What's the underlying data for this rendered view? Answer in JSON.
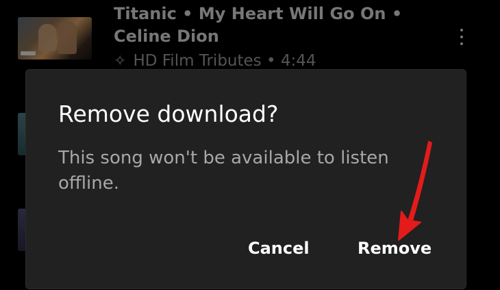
{
  "background_list": {
    "song": {
      "title": "Titanic • My Heart Will Go On • Celine Dion",
      "subtitle": "HD Film Tributes • 4:44",
      "subtitle_icon": "sparkle-icon",
      "menu_icon": "more-vert-icon"
    }
  },
  "dialog": {
    "title": "Remove download?",
    "message": "This song won't be available to listen offline.",
    "cancel_label": "Cancel",
    "remove_label": "Remove"
  },
  "annotation": {
    "type": "arrow",
    "color": "#e31b1b",
    "points_to": "remove-button"
  },
  "colors": {
    "background": "#000000",
    "dialog_background": "#212121",
    "title_text": "#ffffff",
    "message_text": "#a8a8a8",
    "button_text": "#ffffff"
  }
}
